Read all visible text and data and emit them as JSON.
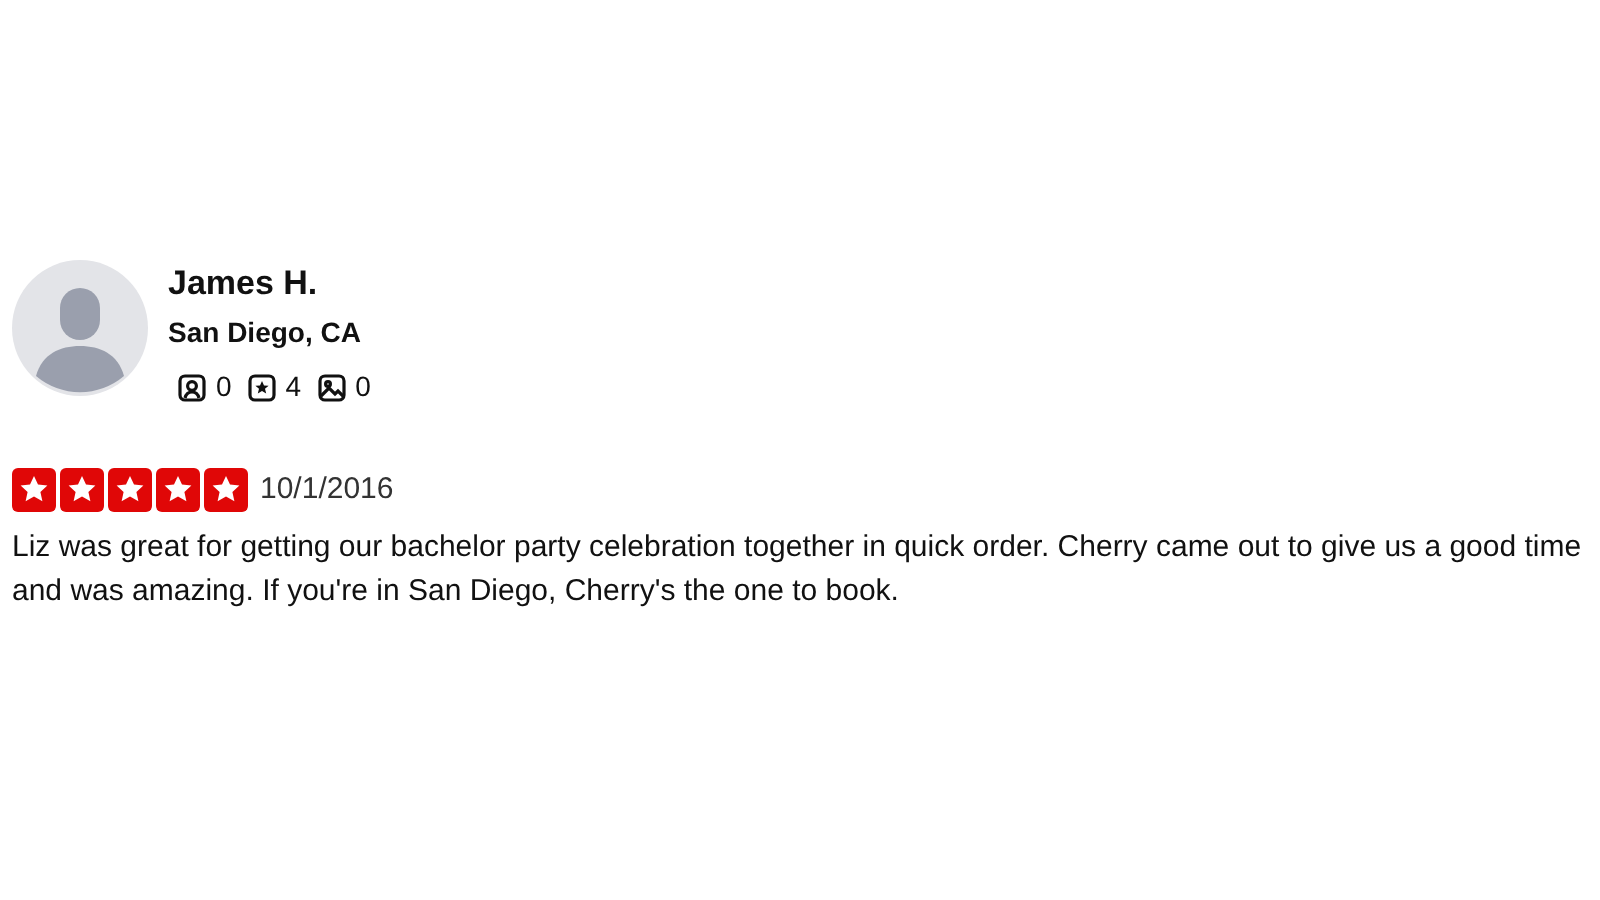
{
  "reviewer": {
    "name": "James H.",
    "location": "San Diego, CA",
    "stats": [
      {
        "kind": "friends",
        "count": "0"
      },
      {
        "kind": "reviews",
        "count": "4"
      },
      {
        "kind": "photos",
        "count": "0"
      }
    ]
  },
  "review": {
    "stars": 5,
    "date": "10/1/2016",
    "text": "Liz was great for getting our bachelor party celebration together in quick order. Cherry came out to give us a good time and was amazing. If you're in San Diego, Cherry's the one to book."
  }
}
